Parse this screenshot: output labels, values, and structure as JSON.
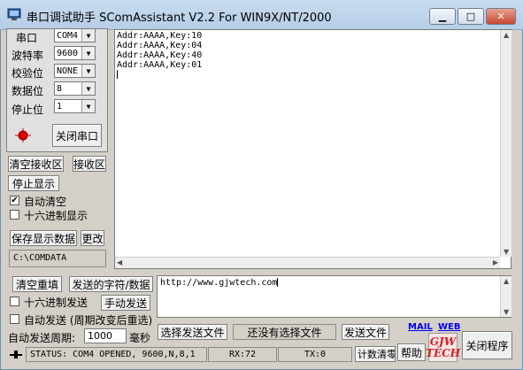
{
  "window": {
    "title": "串口调试助手 SComAssistant V2.2 For WIN9X/NT/2000"
  },
  "settings": {
    "port": {
      "label": "串口",
      "value": "COM4"
    },
    "baud": {
      "label": "波特率",
      "value": "9600"
    },
    "parity": {
      "label": "校验位",
      "value": "NONE"
    },
    "databits": {
      "label": "数据位",
      "value": "8"
    },
    "stopbits": {
      "label": "停止位",
      "value": "1"
    },
    "close_port": "关闭串口"
  },
  "receive": {
    "clear": "清空接收区",
    "area_label": "接收区",
    "stop_display": "停止显示",
    "auto_clear": "自动清空",
    "hex_display": "十六进制显示",
    "save_data": "保存显示数据",
    "change": "更改",
    "path": "C:\\COMDATA",
    "lines": [
      "Addr:AAAA,Key:10",
      "Addr:AAAA,Key:04",
      "Addr:AAAA,Key:40",
      "Addr:AAAA,Key:01"
    ]
  },
  "send": {
    "clear_resend": "清空重填",
    "label": "发送的字符/数据",
    "hex_send": "十六进制发送",
    "manual_send": "手动发送",
    "auto_send": "自动发送 (周期改变后重选)",
    "period_label": "自动发送周期:",
    "period_value": "1000",
    "period_unit": "毫秒",
    "text": "http://www.gjwtech.com",
    "select_file": "选择发送文件",
    "no_file": "还没有选择文件",
    "send_file": "发送文件"
  },
  "links": {
    "mail": "MAIL",
    "web": "WEB"
  },
  "help": "帮助",
  "logo": {
    "line1": "GJW",
    "line2": "TECH"
  },
  "close_program": "关闭程序",
  "status": {
    "text": "STATUS: COM4 OPENED, 9600,N,8,1",
    "rx": "RX:72",
    "tx": "TX:0",
    "count_clear": "计数清零"
  },
  "colors": {
    "led": "#e00000",
    "logo": "#d22020"
  }
}
